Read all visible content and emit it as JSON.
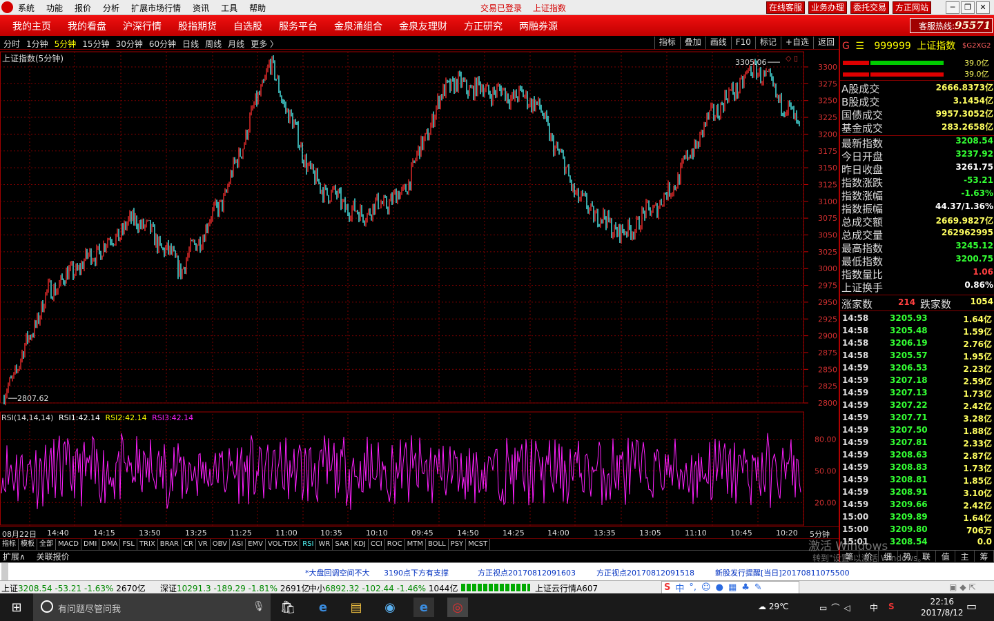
{
  "app": {
    "menu": [
      "系统",
      "功能",
      "报价",
      "分析",
      "扩展市场行情",
      "资讯",
      "工具",
      "帮助"
    ],
    "status": [
      "交易已登录",
      "上证指数"
    ],
    "top_buttons": [
      "在线客服",
      "业务办理",
      "委托交易",
      "方正网站"
    ],
    "window_controls": [
      "─",
      "❐",
      "✕"
    ]
  },
  "nav": {
    "items": [
      "我的主页",
      "我的看盘",
      "沪深行情",
      "股指期货",
      "自选股",
      "服务平台",
      "金泉涌组合",
      "金泉友理财",
      "方正研究",
      "两融券源"
    ],
    "hotline_label": "客服热线:",
    "hotline_number": "95571"
  },
  "toolbar": {
    "periods": [
      "分时",
      "1分钟",
      "5分钟",
      "15分钟",
      "30分钟",
      "60分钟",
      "日线",
      "周线",
      "月线",
      "更多 〉"
    ],
    "active_period": "5分钟",
    "right_buttons": [
      "指标",
      "叠加",
      "画线",
      "F10",
      "标记",
      "+自选",
      "返回"
    ]
  },
  "chart": {
    "title": "上证指数(5分钟)",
    "max_label": "3305.06",
    "min_label": "2807.62",
    "y_ticks": [
      "3300",
      "3275",
      "3250",
      "3225",
      "3200",
      "3175",
      "3150",
      "3125",
      "3100",
      "3075",
      "3050",
      "3025",
      "3000",
      "2975",
      "2950",
      "2925",
      "2900",
      "2875",
      "2850",
      "2825",
      "2800"
    ],
    "rsi_legend": {
      "name": "RSI(14,14,14)",
      "rsi1_label": "RSI1:",
      "rsi1": "42.14",
      "rsi2_label": "RSI2:",
      "rsi2": "42.14",
      "rsi3_label": "RSI3:",
      "rsi3": "42.14"
    },
    "rsi_ticks": [
      "80.00",
      "50.00",
      "20.00"
    ],
    "date_labels": [
      "08月22日",
      "14:40",
      "14:15",
      "13:50",
      "13:25",
      "11:25",
      "11:00",
      "10:35",
      "10:10",
      "09:45",
      "14:50",
      "14:25",
      "14:00",
      "13:35",
      "13:05",
      "11:10",
      "10:45",
      "10:20"
    ],
    "date_period": "5分钟",
    "colors": {
      "up": "#ff3030",
      "down": "#54ffff",
      "rsi": "#ff20ff",
      "grid": "#800000"
    }
  },
  "chart_data": {
    "type": "line",
    "title": "上证指数(5分钟)",
    "xlabel": "",
    "ylabel": "",
    "ylim": [
      2800,
      3310
    ],
    "grid": true,
    "x": [
      "08月22日",
      "14:40",
      "14:15",
      "13:50",
      "13:25",
      "11:25",
      "11:00",
      "10:35",
      "10:10",
      "09:45",
      "14:50",
      "14:25",
      "14:00",
      "13:35",
      "13:05",
      "11:10",
      "10:45",
      "10:20"
    ],
    "series": [
      {
        "values": [
          2807.62,
          2965,
          3020,
          3075,
          3000,
          3110,
          3305.06,
          3130,
          3080,
          3110,
          3275,
          3265,
          3250,
          3100,
          3050,
          3110,
          3230,
          3300,
          3208.54
        ]
      }
    ],
    "rsi": {
      "ylim": [
        0,
        100
      ],
      "levels": [
        20,
        50,
        80
      ],
      "last": 42.14
    }
  },
  "indicator_tabs": [
    "指标",
    "模板",
    "全部",
    "MACD",
    "DMI",
    "DMA",
    "FSL",
    "TRIX",
    "BRAR",
    "CR",
    "VR",
    "OBV",
    "ASI",
    "EMV",
    "VOL-TDX",
    "RSI",
    "WR",
    "SAR",
    "KDJ",
    "CCI",
    "ROC",
    "MTM",
    "BOLL",
    "PSY",
    "MCST"
  ],
  "active_indicator": "RSI",
  "ext_tabs": [
    "扩展∧",
    "关联报价"
  ],
  "panel": {
    "g": "G",
    "menu": "☰",
    "code": "999999",
    "name": "上证指数",
    "tag": "$G2XG2",
    "bar_vals": [
      "39.0亿",
      "39.0亿"
    ],
    "rows": [
      {
        "k": "A股成交",
        "v": "2666.8373亿",
        "c": "#ffff60"
      },
      {
        "k": "B股成交",
        "v": "3.1454亿",
        "c": "#ffff60"
      },
      {
        "k": "国债成交",
        "v": "9957.3052亿",
        "c": "#ffff60"
      },
      {
        "k": "基金成交",
        "v": "283.2658亿",
        "c": "#ffff60"
      },
      {
        "k": "最新指数",
        "v": "3208.54",
        "c": "#33ff33"
      },
      {
        "k": "今日开盘",
        "v": "3237.92",
        "c": "#33ff33"
      },
      {
        "k": "昨日收盘",
        "v": "3261.75",
        "c": "#ffffff"
      },
      {
        "k": "指数涨跌",
        "v": "-53.21",
        "c": "#33ff33"
      },
      {
        "k": "指数涨幅",
        "v": "-1.63%",
        "c": "#33ff33"
      },
      {
        "k": "指数振幅",
        "v": "44.37/1.36%",
        "c": "#ffffff"
      },
      {
        "k": "总成交额",
        "v": "2669.9827亿",
        "c": "#ffff60"
      },
      {
        "k": "总成交量",
        "v": "262962995",
        "c": "#ffff60"
      },
      {
        "k": "最高指数",
        "v": "3245.12",
        "c": "#33ff33"
      },
      {
        "k": "最低指数",
        "v": "3200.75",
        "c": "#33ff33"
      },
      {
        "k": "指数量比",
        "v": "1.06",
        "c": "#ff4040"
      },
      {
        "k": "上证换手",
        "v": "0.86%",
        "c": "#ffffff"
      }
    ],
    "rise_label": "涨家数",
    "rise": "214",
    "fall_label": "跌家数",
    "fall": "1054",
    "ticks": [
      [
        "14:58",
        "3205.93",
        "1.64亿"
      ],
      [
        "14:58",
        "3205.48",
        "1.59亿"
      ],
      [
        "14:58",
        "3206.19",
        "2.76亿"
      ],
      [
        "14:58",
        "3205.57",
        "1.95亿"
      ],
      [
        "14:59",
        "3206.53",
        "2.23亿"
      ],
      [
        "14:59",
        "3207.18",
        "2.59亿"
      ],
      [
        "14:59",
        "3207.13",
        "1.73亿"
      ],
      [
        "14:59",
        "3207.22",
        "2.42亿"
      ],
      [
        "14:59",
        "3207.71",
        "3.28亿"
      ],
      [
        "14:59",
        "3207.50",
        "1.88亿"
      ],
      [
        "14:59",
        "3207.81",
        "2.33亿"
      ],
      [
        "14:59",
        "3208.63",
        "2.87亿"
      ],
      [
        "14:59",
        "3208.83",
        "1.73亿"
      ],
      [
        "14:59",
        "3208.81",
        "1.85亿"
      ],
      [
        "14:59",
        "3208.91",
        "3.10亿"
      ],
      [
        "14:59",
        "3209.66",
        "2.42亿"
      ],
      [
        "15:00",
        "3209.89",
        "1.64亿"
      ],
      [
        "15:00",
        "3209.80",
        "706万"
      ],
      [
        "15:01",
        "3208.54",
        "0.0"
      ]
    ],
    "watermark1": "激活 Windows",
    "watermark2": "转到\"设置\"以激活 Windows。",
    "bottom_tabs": [
      "笔",
      "价",
      "细",
      "势",
      "联",
      "值",
      "主",
      "筹"
    ]
  },
  "news": [
    "*大盘回调空间不大",
    "3190点下方有支撑",
    "方正视点20170812091603",
    "方正视点20170812091518",
    "新股发行提醒[当日]20170811075500"
  ],
  "statusbar": {
    "sh_label": "上证",
    "sh": "3208.54",
    "sh_chg": "-53.21",
    "sh_pct": "-1.63%",
    "sh_vol": "2670亿",
    "sz_label": "深证",
    "sz": "10291.3",
    "sz_chg": "-189.29",
    "sz_pct": "-1.81%",
    "sz_vol": "2691亿",
    "zx_label": "中小",
    "zx": "6892.32",
    "zx_chg": "-102.44",
    "zx_pct": "-1.46%",
    "zx_vol": "1044亿",
    "server": "上证云行情A607"
  },
  "taskbar": {
    "search_placeholder": "有问题尽管问我",
    "temp": "29℃",
    "ime": "中",
    "time": "22:16",
    "date": "2017/8/12"
  }
}
